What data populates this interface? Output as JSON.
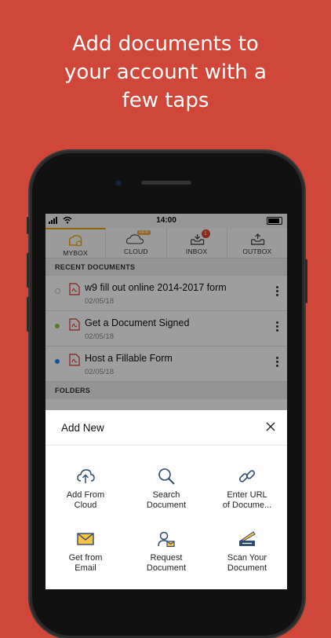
{
  "headline": {
    "line1": "Add documents to",
    "line2": "your account with a",
    "line3": "few taps"
  },
  "status_bar": {
    "time": "14:00"
  },
  "tabs": [
    {
      "label": "MYBOX",
      "icon": "box-icon",
      "active": true
    },
    {
      "label": "CLOUD",
      "icon": "cloud-icon",
      "badge": "NEW"
    },
    {
      "label": "INBOX",
      "icon": "inbox-icon",
      "badge": "1"
    },
    {
      "label": "OUTBOX",
      "icon": "outbox-icon"
    }
  ],
  "recent": {
    "header": "RECENT DOCUMENTS",
    "items": [
      {
        "name": "w9 fill out online 2014-2017 form",
        "date": "02/05/18",
        "dot_color": "none"
      },
      {
        "name": "Get a Document Signed",
        "date": "02/05/18",
        "dot_color": "#8cc63f"
      },
      {
        "name": "Host a Fillable Form",
        "date": "02/05/18",
        "dot_color": "#2f80ed"
      }
    ]
  },
  "folders": {
    "header": "FOLDERS"
  },
  "sheet": {
    "title": "Add New",
    "options": [
      {
        "label_line1": "Add From",
        "label_line2": "Cloud",
        "icon": "cloud-upload-icon"
      },
      {
        "label_line1": "Search",
        "label_line2": "Document",
        "icon": "search-icon"
      },
      {
        "label_line1": "Enter URL",
        "label_line2": "of Docume...",
        "icon": "link-icon"
      },
      {
        "label_line1": "Get from",
        "label_line2": "Email",
        "icon": "mail-icon"
      },
      {
        "label_line1": "Request",
        "label_line2": "Document",
        "icon": "request-user-icon"
      },
      {
        "label_line1": "Scan Your",
        "label_line2": "Document",
        "icon": "scan-icon"
      }
    ]
  },
  "colors": {
    "background": "#d0473a",
    "accent": "#f0a500",
    "icon_blue": "#2c4a72",
    "pdf_red": "#d9342b"
  }
}
